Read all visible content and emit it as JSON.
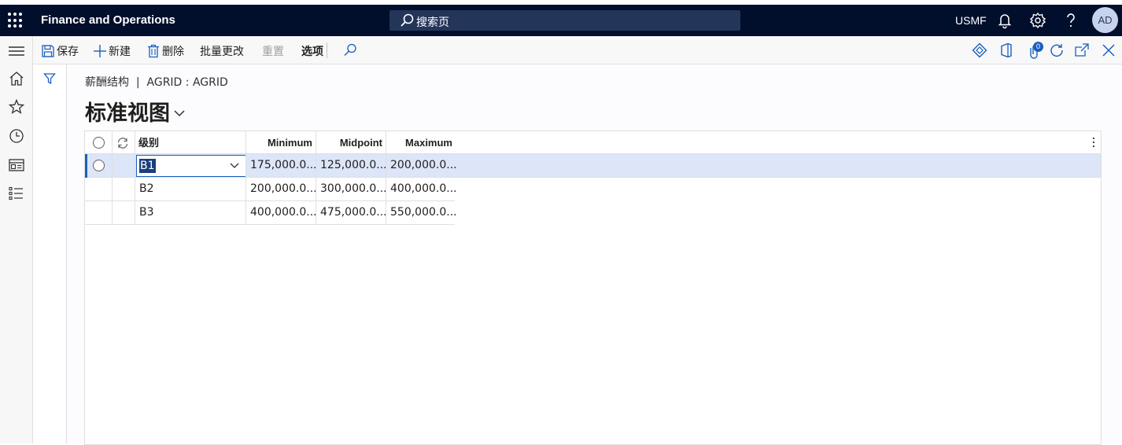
{
  "topbar": {
    "app_title": "Finance and Operations",
    "search_placeholder": "搜索页",
    "company": "USMF",
    "avatar_initials": "AD"
  },
  "actions": {
    "save": "保存",
    "new": "新建",
    "delete": "删除",
    "bulk_edit": "批量更改",
    "reset": "重置",
    "options": "选项"
  },
  "badge_count": "0",
  "breadcrumb": "薪酬结构  |  AGRID : AGRID",
  "view_title": "标准视图",
  "grid": {
    "columns": [
      "级别",
      "Minimum",
      "Midpoint",
      "Maximum"
    ],
    "rows": [
      {
        "level": "B1",
        "minimum": "175,000.0...",
        "midpoint": "125,000.0...",
        "maximum": "200,000.0..."
      },
      {
        "level": "B2",
        "minimum": "200,000.0...",
        "midpoint": "300,000.0...",
        "maximum": "400,000.0..."
      },
      {
        "level": "B3",
        "minimum": "400,000.0...",
        "midpoint": "475,000.0...",
        "maximum": "550,000.0..."
      }
    ]
  },
  "colors": {
    "topbar_bg": "#020f2c",
    "accent": "#1a5fbf",
    "selected_row": "#dde5f8"
  }
}
